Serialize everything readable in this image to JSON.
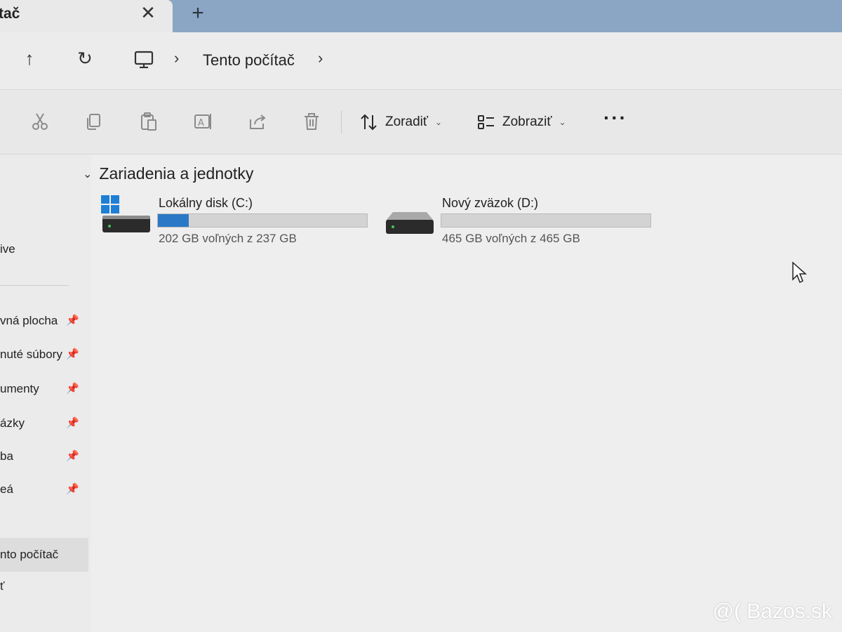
{
  "tab": {
    "title": "tač",
    "close_glyph": "✕",
    "new_tab_glyph": "+"
  },
  "address": {
    "up_glyph": "↑",
    "refresh_glyph": "↻",
    "location_icon": "pc-icon",
    "separator_glyph": "›",
    "current": "Tento počítač"
  },
  "commands": {
    "icons": [
      "cut-icon",
      "copy-icon",
      "paste-icon",
      "rename-icon",
      "share-icon",
      "delete-icon"
    ],
    "sort_label": "Zoradiť",
    "view_label": "Zobraziť",
    "chevron_glyph": "⌄",
    "more_glyph": "···"
  },
  "sidebar": {
    "items": [
      {
        "label": "ive",
        "pinned": false
      },
      {
        "label": "vná plocha",
        "pinned": true
      },
      {
        "label": "nuté súbory",
        "pinned": true
      },
      {
        "label": "umenty",
        "pinned": true
      },
      {
        "label": "ázky",
        "pinned": true
      },
      {
        "label": "ba",
        "pinned": true
      },
      {
        "label": "eá",
        "pinned": true
      },
      {
        "label": "nto počítač",
        "pinned": false
      },
      {
        "label": "ť",
        "pinned": false
      }
    ],
    "pin_glyph": "📌"
  },
  "main": {
    "section_title": "Zariadenia a jednotky",
    "section_chevron": "⌄",
    "drives": [
      {
        "name": "Lokálny disk (C:)",
        "free_text": "202 GB voľných z 237 GB",
        "used_fraction": 0.148,
        "system_drive": true
      },
      {
        "name": "Nový zväzok (D:)",
        "free_text": "465 GB voľných z 465 GB",
        "used_fraction": 0.0,
        "system_drive": false
      }
    ]
  },
  "colors": {
    "accent": "#2b79c6",
    "tabstrip": "#8aa6c4",
    "background": "#eeeeee"
  },
  "watermark": "@( Bazos.sk"
}
